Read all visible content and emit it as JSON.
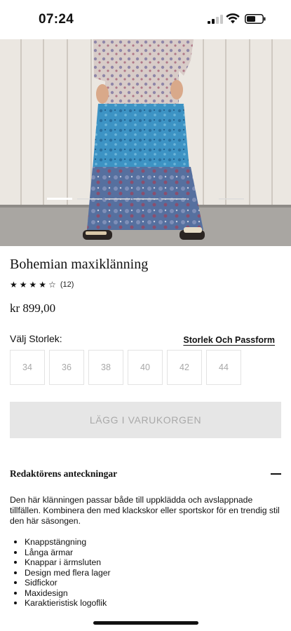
{
  "status_bar": {
    "time": "07:24"
  },
  "hero": {
    "image": "product-photo-bohemian-maxi-dress",
    "carousel_dots": 6,
    "active_dot": 0
  },
  "product": {
    "title": "Bohemian maxiklänning",
    "rating": 4,
    "rating_max": 5,
    "review_count": "(12)",
    "price": "kr 899,00"
  },
  "size_selector": {
    "label": "Välj Storlek:",
    "guide_link": "Storlek Och Passform",
    "sizes": [
      "34",
      "36",
      "38",
      "40",
      "42",
      "44"
    ]
  },
  "cart": {
    "add_label": "LÄGG I VARUKORGEN"
  },
  "notes": {
    "heading": "Redaktörens anteckningar",
    "description": "Den här klänningen passar både till uppklädda och avslappnade tillfällen. Kombinera den med klackskor eller sportskor för en trendig stil den här säsongen.",
    "bullets": [
      "Knappstängning",
      "Långa ärmar",
      "Knappar i ärmsluten",
      "Design med flera lager",
      "Sidfickor",
      "Maxidesign",
      "Karaktieristisk logoflik"
    ]
  },
  "colors": {
    "skirt_blue": "#3b8fc0",
    "skirt_dark": "#4a6a9a",
    "button_disabled_bg": "#e6e6e6"
  }
}
